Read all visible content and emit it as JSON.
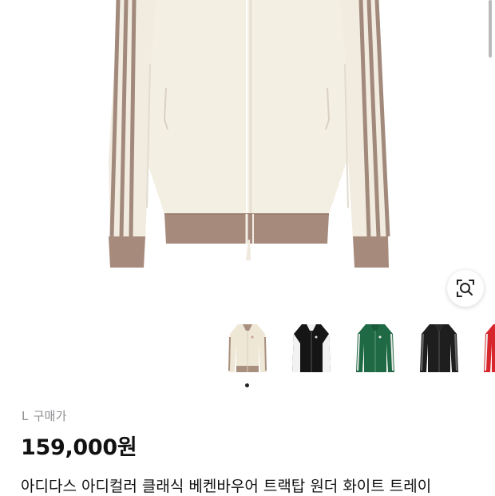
{
  "product": {
    "size": "L",
    "price_type": "구매가",
    "price": "159,000원",
    "title": "아디다스 아디컬러 클래식 베켄바우어 트랙탑 원더 화이트 트레이"
  },
  "gallery": {
    "selected_index": 0,
    "thumbnails": [
      {
        "name": "wonder-white",
        "body": "#efe7d6",
        "trim": "#a88f7e"
      },
      {
        "name": "black-white",
        "body": "#151515",
        "trim": "#f2f2f2"
      },
      {
        "name": "green",
        "body": "#1f6a44",
        "trim": "#e8e8e8"
      },
      {
        "name": "black",
        "body": "#1e1e1e",
        "trim": "#6a6a6a"
      },
      {
        "name": "red",
        "body": "#d7262c",
        "trim": "#f2f2f2"
      }
    ]
  },
  "icons": {
    "lens": "visual-search-icon"
  },
  "colors": {
    "jacket_body": "#f3eee2",
    "stripe": "#a18a7c",
    "rib": "#a68a7c"
  }
}
